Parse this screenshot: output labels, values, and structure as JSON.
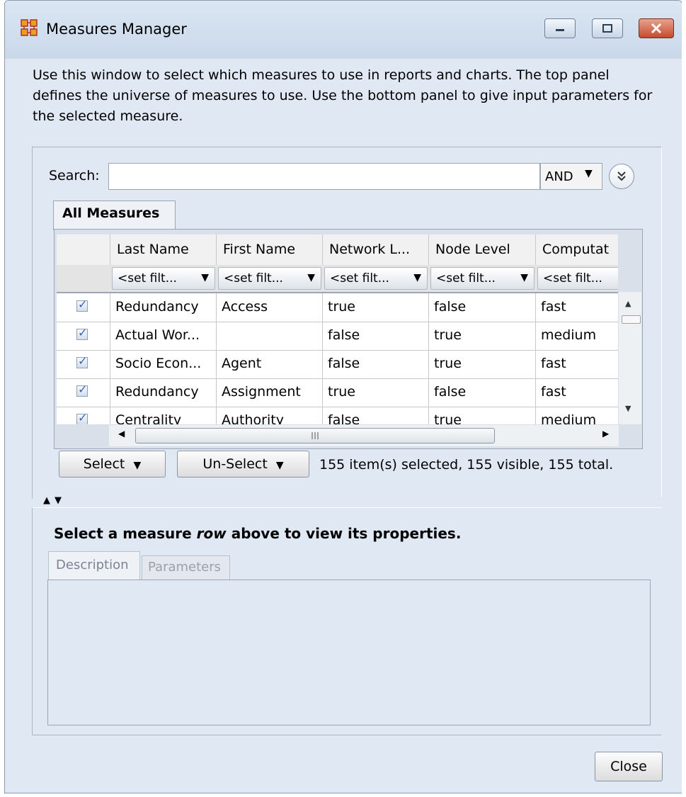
{
  "window": {
    "title": "Measures Manager",
    "min_icon": "minimize-icon",
    "max_icon": "maximize-icon",
    "close_icon": "close-icon"
  },
  "intro_text": "Use this window to select which measures to use in reports and charts. The top panel defines the universe of measures to use. Use the bottom panel to give input parameters for the selected measure.",
  "search": {
    "label": "Search:",
    "value": "",
    "operator": "AND"
  },
  "tab_all_measures": "All Measures",
  "table": {
    "columns": [
      "Last Name",
      "First Name",
      "Network L...",
      "Node Level",
      "Computat"
    ],
    "filter_placeholder": "<set filt...",
    "rows": [
      {
        "checked": true,
        "last": "Redundancy",
        "first": "Access",
        "network": "true",
        "node": "false",
        "comp": "fast"
      },
      {
        "checked": true,
        "last": "Actual Wor...",
        "first": "",
        "network": "false",
        "node": "true",
        "comp": "medium"
      },
      {
        "checked": true,
        "last": "Socio Econ...",
        "first": "Agent",
        "network": "false",
        "node": "true",
        "comp": "fast"
      },
      {
        "checked": true,
        "last": "Redundancy",
        "first": "Assignment",
        "network": "true",
        "node": "false",
        "comp": "fast"
      },
      {
        "checked": true,
        "last": "Centrality",
        "first": "Authority",
        "network": "false",
        "node": "true",
        "comp": "medium"
      }
    ]
  },
  "buttons": {
    "select": "Select",
    "unselect": "Un-Select",
    "close": "Close"
  },
  "status": "155 item(s) selected, 155 visible, 155 total.",
  "properties": {
    "heading_part1": "Select a measure ",
    "heading_italic": "row",
    "heading_part2": " above to view its properties.",
    "tab_description": "Description",
    "tab_parameters": "Parameters"
  },
  "colors": {
    "window_bg": "#dfe8f3",
    "check_color": "#3a63b5",
    "close_button": "#c64a2c"
  }
}
